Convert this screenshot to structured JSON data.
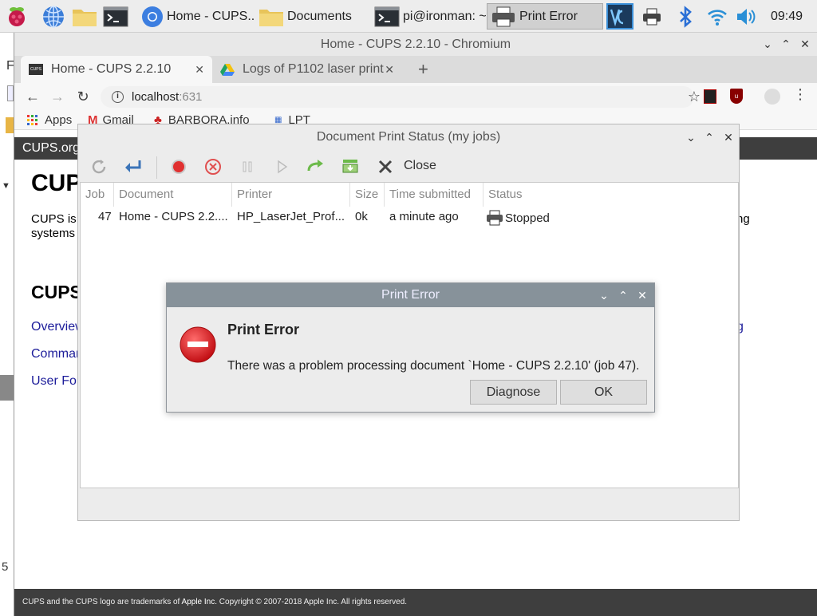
{
  "taskbar": {
    "tasks": [
      {
        "label": "Home - CUPS..."
      },
      {
        "label": "Documents"
      },
      {
        "label": "pi@ironman: ~"
      },
      {
        "label": "Print Error"
      }
    ],
    "clock": "09:49"
  },
  "browser": {
    "window_title": "Home - CUPS 2.2.10 - Chromium",
    "tabs": [
      {
        "label": "Home - CUPS 2.2.10"
      },
      {
        "label": "Logs of P1102 laser print"
      }
    ],
    "favicon_cups": "CUPS",
    "url_host": "localhost",
    "url_port": ":631",
    "bookmarks": [
      {
        "label": "Apps"
      },
      {
        "label": "Gmail"
      },
      {
        "label": "BARBORA.info"
      },
      {
        "label": "LPT"
      }
    ]
  },
  "cups_page": {
    "header": "CUPS.org",
    "heading1": "CUPS",
    "intro_line1": "CUPS is",
    "intro_line2": "systems",
    "intro_tail": "ng",
    "heading2": "CUPS",
    "links": [
      "Overview",
      "Comman",
      "User For"
    ],
    "link_tail": "g",
    "footer_prefix": "CUPS and the CUPS logo are trademarks of ",
    "footer_brand": "Apple Inc.",
    "footer_suffix": " Copyright © 2007-2018 Apple Inc. All rights reserved."
  },
  "left_column": {
    "letter_top": "F",
    "letter_bottom": "5"
  },
  "jobs_window": {
    "title": "Document Print Status (my jobs)",
    "close_label": "Close",
    "columns": [
      "Job",
      "Document",
      "Printer",
      "Size",
      "Time submitted",
      "Status"
    ],
    "rows": [
      {
        "job": "47",
        "document": "Home - CUPS 2.2....",
        "printer": "HP_LaserJet_Prof...",
        "size": "0k",
        "time": "a minute ago",
        "status": "Stopped"
      }
    ]
  },
  "error_dialog": {
    "title": "Print Error",
    "heading": "Print Error",
    "message": "There was a problem processing document `Home - CUPS 2.2.10' (job 47).",
    "diagnose_label": "Diagnose",
    "ok_label": "OK"
  },
  "colors": {
    "dialog_titlebar": "#87929a",
    "cups_header": "#3e3e3e",
    "link": "#1c1c9a",
    "error_red": "#d7141a"
  }
}
